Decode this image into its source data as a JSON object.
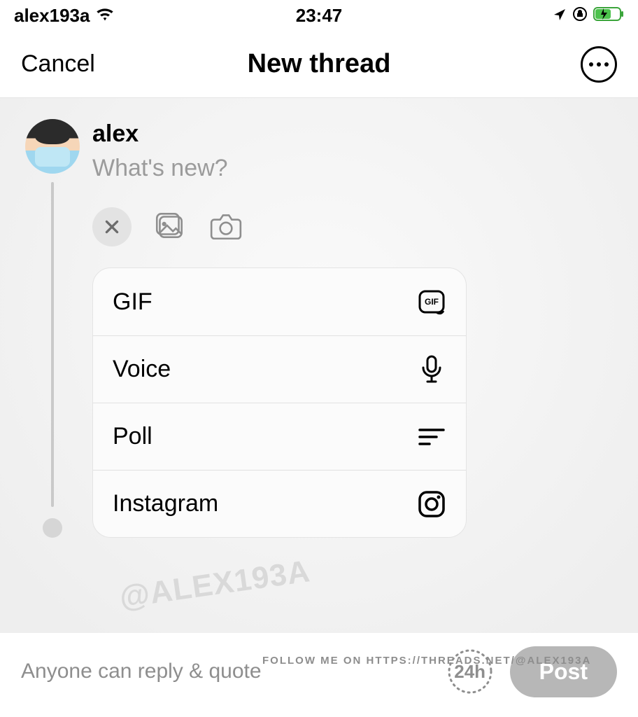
{
  "status": {
    "carrier": "alex193a",
    "time": "23:47"
  },
  "nav": {
    "cancel": "Cancel",
    "title": "New thread"
  },
  "composer": {
    "username": "alex",
    "placeholder": "What's new?"
  },
  "menu": {
    "items": [
      {
        "label": "GIF"
      },
      {
        "label": "Voice"
      },
      {
        "label": "Poll"
      },
      {
        "label": "Instagram"
      }
    ]
  },
  "watermark": "@ALEX193A",
  "follow_tag": "FOLLOW ME ON HTTPS://THREADS.NET/@ALEX193A",
  "footer": {
    "reply_scope": "Anyone can reply & quote",
    "time_pill": "24h",
    "post": "Post"
  }
}
